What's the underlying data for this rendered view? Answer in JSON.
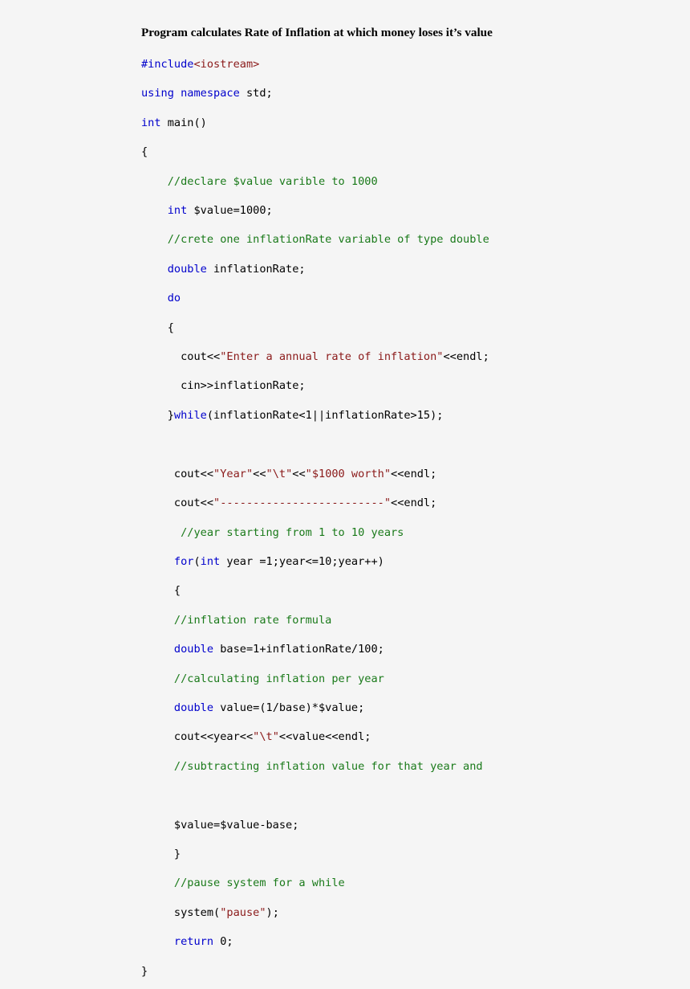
{
  "document": {
    "title": "Program calculates Rate of Inflation at which money loses it’s value",
    "language": "C++",
    "background_color": "#f5f5f5",
    "colors": {
      "keyword": "#0000cc",
      "string": "#8b1a1a",
      "comment": "#1a7a1a",
      "plain": "#000000"
    }
  },
  "code": {
    "lines": [
      {
        "tokens": [
          {
            "t": "kw",
            "s": "#include"
          },
          {
            "t": "str",
            "s": "<iostream>"
          }
        ]
      },
      {
        "tokens": [
          {
            "t": "kw",
            "s": "using namespace"
          },
          {
            "t": "plain",
            "s": " std;"
          }
        ]
      },
      {
        "tokens": [
          {
            "t": "kw",
            "s": "int"
          },
          {
            "t": "plain",
            "s": " main()"
          }
        ]
      },
      {
        "tokens": [
          {
            "t": "plain",
            "s": "{"
          }
        ]
      },
      {
        "tokens": [
          {
            "t": "cmt",
            "s": "    //declare $value varible to 1000"
          }
        ]
      },
      {
        "tokens": [
          {
            "t": "kw",
            "s": "    int"
          },
          {
            "t": "plain",
            "s": " $value=1000;"
          }
        ]
      },
      {
        "tokens": [
          {
            "t": "cmt",
            "s": "    //crete one inflationRate variable of type double"
          }
        ]
      },
      {
        "tokens": [
          {
            "t": "kw",
            "s": "    double"
          },
          {
            "t": "plain",
            "s": " inflationRate;"
          }
        ]
      },
      {
        "tokens": [
          {
            "t": "kw",
            "s": "    do"
          }
        ]
      },
      {
        "tokens": [
          {
            "t": "plain",
            "s": "    {"
          }
        ]
      },
      {
        "tokens": [
          {
            "t": "plain",
            "s": "      cout<<"
          },
          {
            "t": "str",
            "s": "\"Enter a annual rate of inflation\""
          },
          {
            "t": "plain",
            "s": "<<endl;"
          }
        ]
      },
      {
        "tokens": [
          {
            "t": "plain",
            "s": "      cin>>inflationRate;"
          }
        ]
      },
      {
        "tokens": [
          {
            "t": "plain",
            "s": "    }"
          },
          {
            "t": "kw",
            "s": "while"
          },
          {
            "t": "plain",
            "s": "(inflationRate<1||inflationRate>15);"
          }
        ]
      },
      {
        "tokens": []
      },
      {
        "tokens": [
          {
            "t": "plain",
            "s": "     cout<<"
          },
          {
            "t": "str",
            "s": "\"Year\""
          },
          {
            "t": "plain",
            "s": "<<"
          },
          {
            "t": "str",
            "s": "\"\\t\""
          },
          {
            "t": "plain",
            "s": "<<"
          },
          {
            "t": "str",
            "s": "\"$1000 worth\""
          },
          {
            "t": "plain",
            "s": "<<endl;"
          }
        ]
      },
      {
        "tokens": [
          {
            "t": "plain",
            "s": "     cout<<"
          },
          {
            "t": "str",
            "s": "\"-------------------------\""
          },
          {
            "t": "plain",
            "s": "<<endl;"
          }
        ]
      },
      {
        "tokens": [
          {
            "t": "cmt",
            "s": "      //year starting from 1 to 10 years"
          }
        ]
      },
      {
        "tokens": [
          {
            "t": "kw",
            "s": "     for"
          },
          {
            "t": "plain",
            "s": "("
          },
          {
            "t": "kw",
            "s": "int"
          },
          {
            "t": "plain",
            "s": " year =1;year<=10;year++)"
          }
        ]
      },
      {
        "tokens": [
          {
            "t": "plain",
            "s": "     {"
          }
        ]
      },
      {
        "tokens": [
          {
            "t": "cmt",
            "s": "     //inflation rate formula"
          }
        ]
      },
      {
        "tokens": [
          {
            "t": "kw",
            "s": "     double"
          },
          {
            "t": "plain",
            "s": " base=1+inflationRate/100;"
          }
        ]
      },
      {
        "tokens": [
          {
            "t": "cmt",
            "s": "     //calculating inflation per year"
          }
        ]
      },
      {
        "tokens": [
          {
            "t": "kw",
            "s": "     double"
          },
          {
            "t": "plain",
            "s": " value=(1/base)*$value;"
          }
        ]
      },
      {
        "tokens": [
          {
            "t": "plain",
            "s": "     cout<<year<<"
          },
          {
            "t": "str",
            "s": "\"\\t\""
          },
          {
            "t": "plain",
            "s": "<<value<<endl;"
          }
        ]
      },
      {
        "tokens": [
          {
            "t": "cmt",
            "s": "     //subtracting inflation value for that year and"
          }
        ]
      },
      {
        "tokens": []
      },
      {
        "tokens": [
          {
            "t": "plain",
            "s": "     $value=$value-base;"
          }
        ]
      },
      {
        "tokens": [
          {
            "t": "plain",
            "s": "     }"
          }
        ]
      },
      {
        "tokens": [
          {
            "t": "cmt",
            "s": "     //pause system for a while"
          }
        ]
      },
      {
        "tokens": [
          {
            "t": "plain",
            "s": "     system("
          },
          {
            "t": "str",
            "s": "\"pause\""
          },
          {
            "t": "plain",
            "s": ");"
          }
        ]
      },
      {
        "tokens": [
          {
            "t": "kw",
            "s": "     return"
          },
          {
            "t": "plain",
            "s": " 0;"
          }
        ]
      },
      {
        "tokens": [
          {
            "t": "plain",
            "s": "}"
          }
        ]
      }
    ]
  }
}
